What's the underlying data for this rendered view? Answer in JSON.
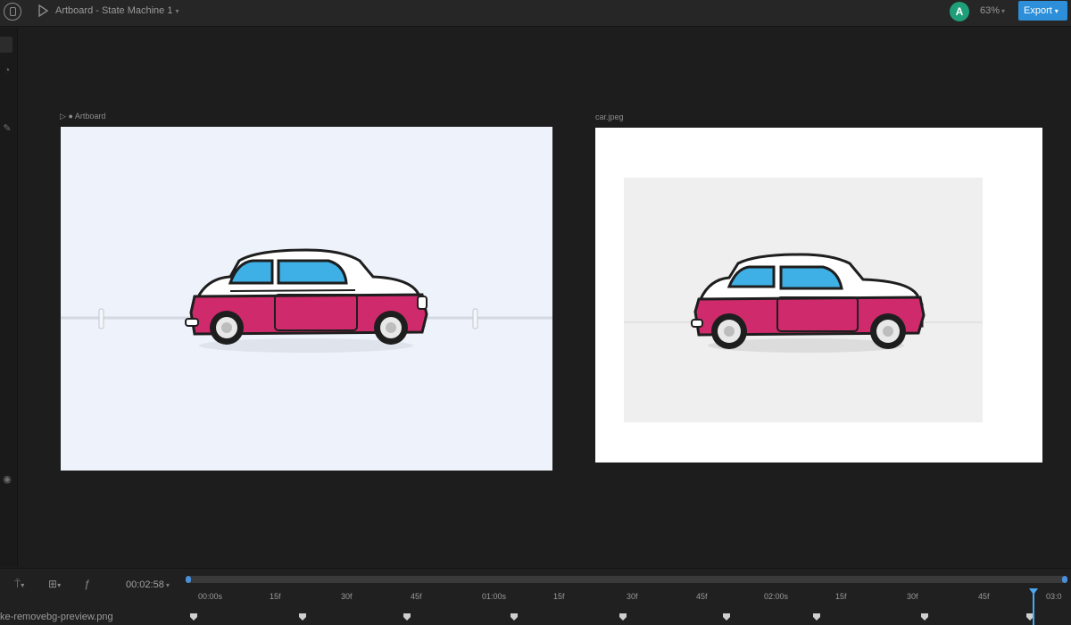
{
  "topbar": {
    "title": "Artboard - State Machine 1",
    "avatar_letter": "A",
    "zoom": "63%",
    "export_label": "Export",
    "accent": "#2d8ed9"
  },
  "stage": {
    "artboard_label": "Artboard",
    "image_label": "car.jpeg"
  },
  "timeline": {
    "timecode": "00:02:58",
    "filename": "ke-removebg-preview.png",
    "ruler": [
      "00:00s",
      "15f",
      "30f",
      "45f",
      "01:00s",
      "15f",
      "30f",
      "45f",
      "02:00s",
      "15f",
      "30f",
      "45f",
      "03:0"
    ],
    "keyframe_count": 9
  },
  "colors": {
    "car_body": "#cf2a6b",
    "car_window": "#3fb0e6",
    "playhead": "#4aa8f0"
  }
}
